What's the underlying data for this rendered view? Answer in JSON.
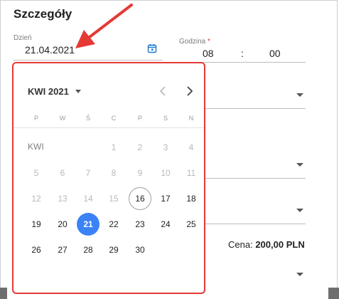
{
  "title": "Szczegóły",
  "date_field": {
    "label": "Dzień",
    "value": "21.04.2021",
    "icon": "calendar-icon"
  },
  "time_field": {
    "label": "Godzina",
    "required_mark": "*",
    "hours": "08",
    "separator": ":",
    "minutes": "00"
  },
  "price": {
    "label": "Cena:",
    "value": "200,00 PLN"
  },
  "datepicker": {
    "month_label": "KWI 2021",
    "prev_icon": "chevron-left-icon",
    "next_icon": "chevron-right-icon",
    "weekdays": [
      "P",
      "W",
      "Ś",
      "C",
      "P",
      "S",
      "N"
    ],
    "month_short": "KWI",
    "selected_day": "21",
    "today_day": "16",
    "days": [
      {
        "d": "1",
        "state": "disabled"
      },
      {
        "d": "2",
        "state": "disabled"
      },
      {
        "d": "3",
        "state": "disabled"
      },
      {
        "d": "4",
        "state": "disabled"
      },
      {
        "d": "5",
        "state": "disabled"
      },
      {
        "d": "6",
        "state": "disabled"
      },
      {
        "d": "7",
        "state": "disabled"
      },
      {
        "d": "8",
        "state": "disabled"
      },
      {
        "d": "9",
        "state": "disabled"
      },
      {
        "d": "10",
        "state": "disabled"
      },
      {
        "d": "11",
        "state": "disabled"
      },
      {
        "d": "12",
        "state": "disabled"
      },
      {
        "d": "13",
        "state": "disabled"
      },
      {
        "d": "14",
        "state": "disabled"
      },
      {
        "d": "15",
        "state": "disabled"
      },
      {
        "d": "16",
        "state": "today"
      },
      {
        "d": "17",
        "state": "enabled"
      },
      {
        "d": "18",
        "state": "enabled"
      },
      {
        "d": "19",
        "state": "enabled"
      },
      {
        "d": "20",
        "state": "enabled"
      },
      {
        "d": "21",
        "state": "selected"
      },
      {
        "d": "22",
        "state": "enabled"
      },
      {
        "d": "23",
        "state": "enabled"
      },
      {
        "d": "24",
        "state": "enabled"
      },
      {
        "d": "25",
        "state": "enabled"
      },
      {
        "d": "26",
        "state": "enabled"
      },
      {
        "d": "27",
        "state": "enabled"
      },
      {
        "d": "28",
        "state": "enabled"
      },
      {
        "d": "29",
        "state": "enabled"
      },
      {
        "d": "30",
        "state": "enabled"
      }
    ]
  },
  "colors": {
    "accent": "#3b82f6",
    "highlight_border": "#e53935",
    "arrow": "#e53935"
  }
}
